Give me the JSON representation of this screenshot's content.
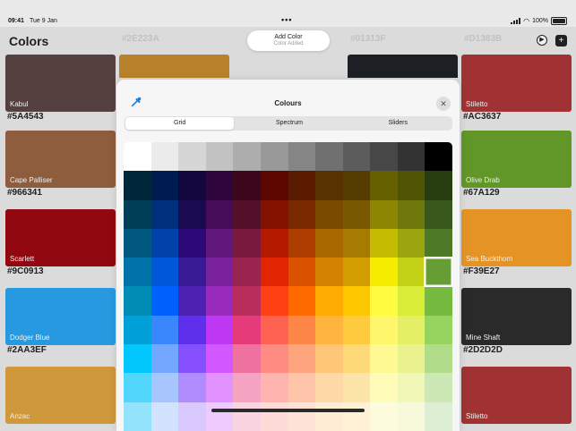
{
  "status": {
    "time": "09:41",
    "date": "Tue 9 Jan",
    "battery": "100%"
  },
  "header": {
    "title": "Colors",
    "ghost_hex_1": "#2E223A",
    "ghost_hex_2": "#01313F",
    "ghost_hex_3": "#D1383B"
  },
  "toast": {
    "title": "Add Color",
    "subtitle": "Color Added"
  },
  "left_cards": [
    {
      "name": "Kabul",
      "hex": "#5A4543",
      "color": "#5A4543"
    },
    {
      "name": "Cape Palliser",
      "hex": "#966341",
      "color": "#966341"
    },
    {
      "name": "Scarlett",
      "hex": "#9C0913",
      "color": "#9C0913"
    },
    {
      "name": "Dodger Blue",
      "hex": "#2AA3EF",
      "color": "#2AA3EF"
    },
    {
      "name": "Anzac",
      "hex": "",
      "color": "#DBA23F"
    }
  ],
  "right_cards": [
    {
      "name": "Stiletto",
      "hex": "#AC3637",
      "color": "#AC3637"
    },
    {
      "name": "Olive Drab",
      "hex": "#67A129",
      "color": "#67A129"
    },
    {
      "name": "Sea Buckthorn",
      "hex": "#F39E27",
      "color": "#F39E27"
    },
    {
      "name": "Mine Shaft",
      "hex": "#2D2D2D",
      "color": "#2D2D2D"
    },
    {
      "name": "Stiletto",
      "hex": "",
      "color": "#AC3637"
    }
  ],
  "modal": {
    "title": "Colours",
    "tabs": [
      "Grid",
      "Spectrum",
      "Sliders"
    ],
    "active_tab": 0
  },
  "palette_rows": [
    [
      "#ffffff",
      "#ebebeb",
      "#d6d6d6",
      "#c2c2c2",
      "#adadad",
      "#999999",
      "#858585",
      "#707070",
      "#5c5c5c",
      "#474747",
      "#333333",
      "#000000"
    ],
    [
      "#00263a",
      "#001b4f",
      "#12083e",
      "#2e063d",
      "#3c071b",
      "#5b0700",
      "#5a1b00",
      "#583300",
      "#553d00",
      "#666100",
      "#4f5504",
      "#263e0f"
    ],
    [
      "#003e57",
      "#002f7b",
      "#1a0a52",
      "#450d59",
      "#541029",
      "#831100",
      "#7b2900",
      "#7a4a00",
      "#785800",
      "#8c8602",
      "#6f760a",
      "#38571a"
    ],
    [
      "#005880",
      "#0042a9",
      "#2c0977",
      "#61187c",
      "#791a3d",
      "#b51a00",
      "#ad3e00",
      "#a96800",
      "#a67b01",
      "#c4bc00",
      "#9ba50e",
      "#4e7a27"
    ],
    [
      "#0074a9",
      "#0057d7",
      "#371a94",
      "#7a219e",
      "#99244f",
      "#e22400",
      "#da5100",
      "#d38301",
      "#d19d01",
      "#f5ec00",
      "#c3d117",
      "#669d34"
    ],
    [
      "#008cb4",
      "#0061fe",
      "#4d22b2",
      "#982abc",
      "#b92d5d",
      "#ff4015",
      "#ff6a00",
      "#ffab01",
      "#fdc700",
      "#fefb41",
      "#d9ec37",
      "#76bb40"
    ],
    [
      "#00a1d8",
      "#3a87fd",
      "#5e30eb",
      "#be38f3",
      "#e63b7a",
      "#fe6250",
      "#fe8648",
      "#feb43f",
      "#fecb3e",
      "#fff76b",
      "#e4ef65",
      "#96d35f"
    ],
    [
      "#01c7fc",
      "#74a7ff",
      "#864ffe",
      "#d357fe",
      "#ee719e",
      "#ff8c82",
      "#fea57d",
      "#fec777",
      "#fed977",
      "#fff994",
      "#eaf28f",
      "#b1dd8b"
    ],
    [
      "#52d6fc",
      "#a8c6fe",
      "#b18cfe",
      "#e292fe",
      "#f4a4c0",
      "#ffb5af",
      "#ffc5ab",
      "#fed9a8",
      "#fde4a8",
      "#fffbb9",
      "#f1f7b7",
      "#cde8b5"
    ],
    [
      "#93e3fd",
      "#d3e2fe",
      "#d9c9fe",
      "#efcafe",
      "#f9d3e0",
      "#ffdbd8",
      "#ffe2d6",
      "#feecd4",
      "#fef1d5",
      "#fdfbdd",
      "#f6fadb",
      "#deeed4"
    ]
  ],
  "selected_swatch": "#669d34"
}
